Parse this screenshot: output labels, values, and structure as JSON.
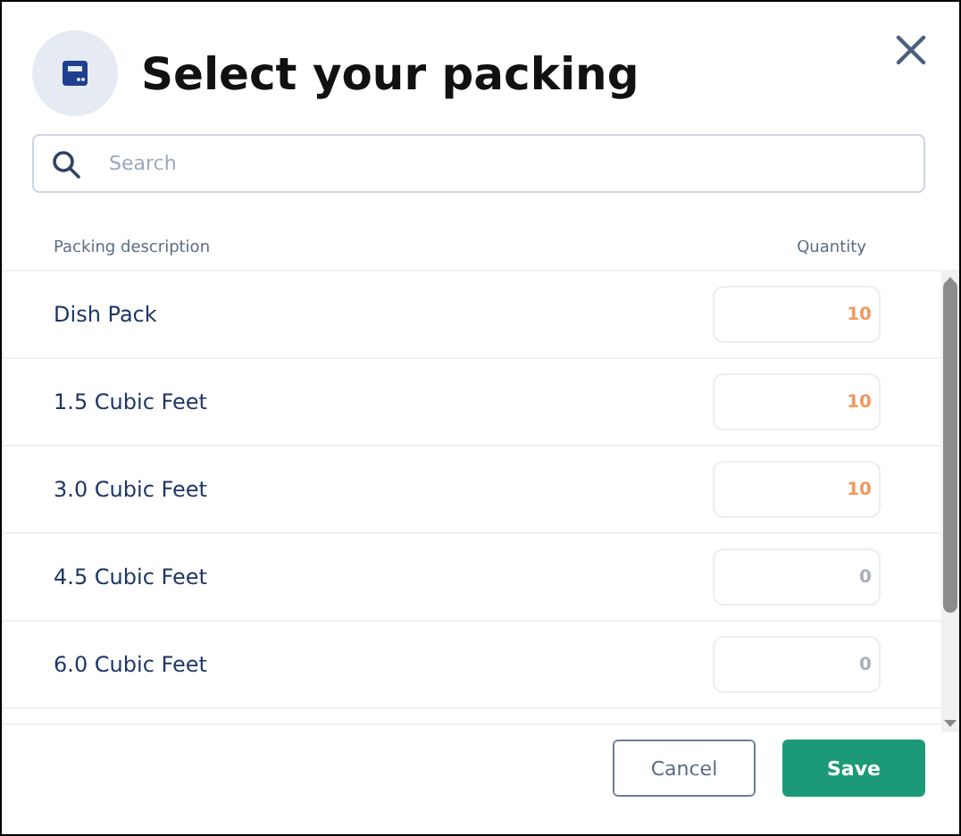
{
  "dialog": {
    "title": "Select your packing"
  },
  "search": {
    "placeholder": "Search"
  },
  "table": {
    "columns": [
      "Packing description",
      "Quantity"
    ],
    "rows": [
      {
        "description": "Dish Pack",
        "quantity": "10",
        "filled": true
      },
      {
        "description": "1.5 Cubic Feet",
        "quantity": "10",
        "filled": true
      },
      {
        "description": "3.0 Cubic Feet",
        "quantity": "10",
        "filled": true
      },
      {
        "description": "4.5 Cubic Feet",
        "quantity": "0",
        "filled": false
      },
      {
        "description": "6.0 Cubic Feet",
        "quantity": "0",
        "filled": false
      }
    ]
  },
  "buttons": [
    {
      "label": "Cancel",
      "kind": "secondary"
    },
    {
      "label": "Save",
      "kind": "primary"
    }
  ]
}
